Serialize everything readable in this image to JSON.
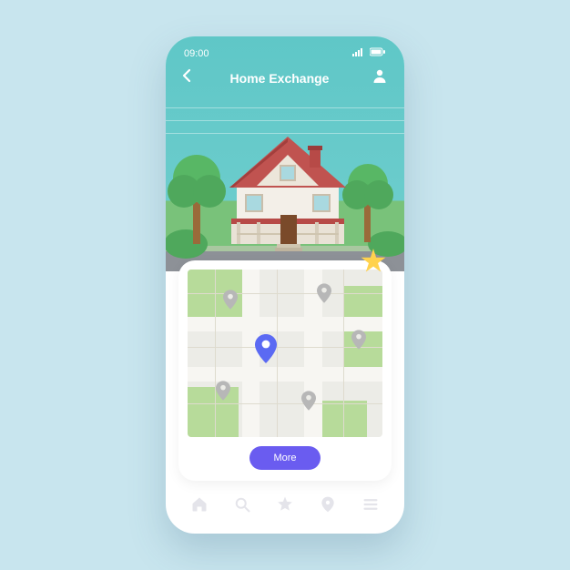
{
  "status": {
    "time": "09:00"
  },
  "header": {
    "title": "Home Exchange"
  },
  "actions": {
    "more_label": "More"
  },
  "colors": {
    "accent": "#6a5cf0",
    "star": "#ffd24d",
    "pin_main": "#5b6af3",
    "pin_muted": "#b7b7b7",
    "sky": "#5fc7c7",
    "grass": "#79c27a"
  },
  "nav": {
    "items": [
      "home",
      "search",
      "favorites",
      "map-pin",
      "menu"
    ]
  }
}
